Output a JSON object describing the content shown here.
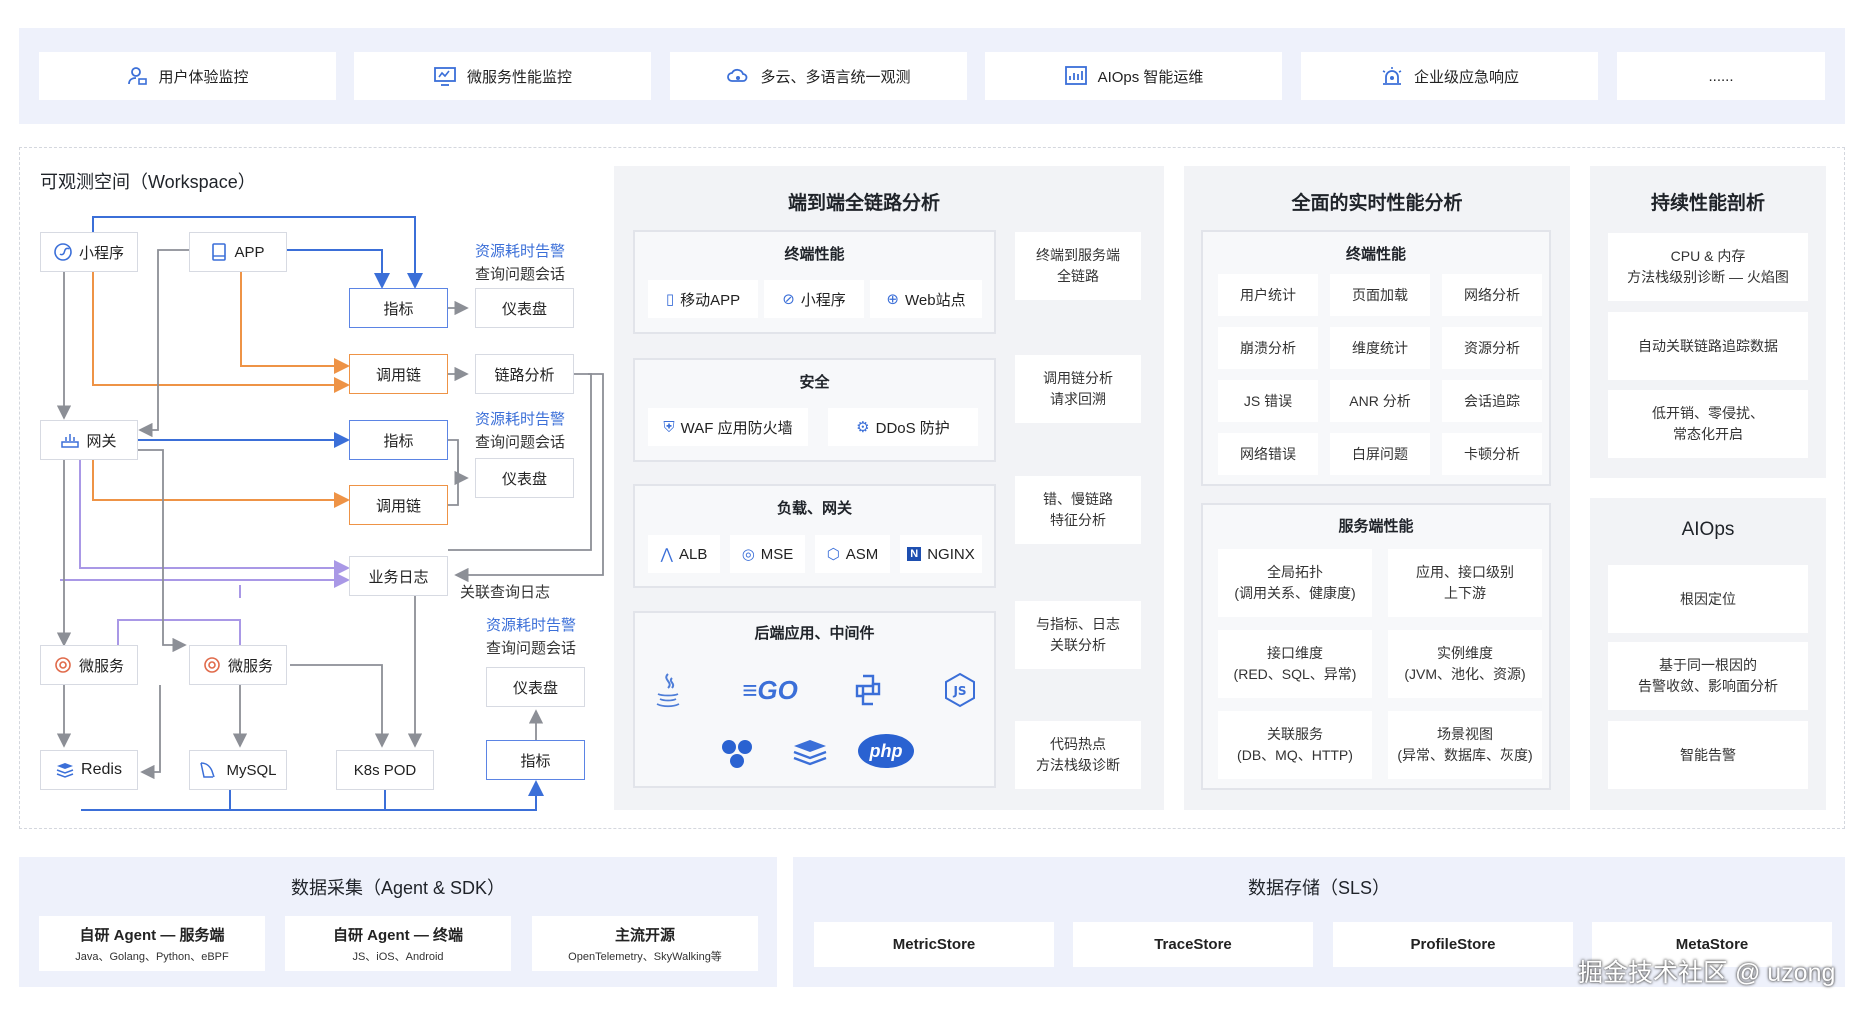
{
  "top_bar": {
    "items": [
      {
        "label": "用户体验监控",
        "icon": "user-monitor-icon"
      },
      {
        "label": "微服务性能监控",
        "icon": "screen-monitor-icon"
      },
      {
        "label": "多云、多语言统一观测",
        "icon": "cloud-icon"
      },
      {
        "label": "AIOps 智能运维",
        "icon": "chart-icon"
      },
      {
        "label": "企业级应急响应",
        "icon": "alarm-icon"
      },
      {
        "label": "......"
      }
    ]
  },
  "workspace": {
    "title": "可观测空间（Workspace）",
    "nodes": {
      "miniprogram": "小程序",
      "app": "APP",
      "gateway": "网关",
      "microservice1": "微服务",
      "microservice2": "微服务",
      "redis": "Redis",
      "mysql": "MySQL",
      "k8s": "K8s POD",
      "metric1": "指标",
      "trace1": "调用链",
      "metric2": "指标",
      "trace2": "调用链",
      "bizlog": "业务日志",
      "metric3": "指标",
      "dashboard1": "仪表盘",
      "tracelink": "链路分析",
      "dashboard2": "仪表盘",
      "dashboard3": "仪表盘"
    },
    "alerts": [
      {
        "line1": "资源耗时告警",
        "line2": "查询问题会话"
      },
      {
        "line1": "资源耗时告警",
        "line2": "查询问题会话"
      },
      {
        "line1": "资源耗时告警",
        "line2": "查询问题会话"
      }
    ],
    "related_log": "关联查询日志"
  },
  "e2e": {
    "title": "端到端全链路分析",
    "terminal": {
      "title": "终端性能",
      "items": [
        "移动APP",
        "小程序",
        "Web站点"
      ]
    },
    "security": {
      "title": "安全",
      "items": [
        "WAF 应用防火墙",
        "DDoS 防护"
      ]
    },
    "lb": {
      "title": "负载、网关",
      "items": [
        "ALB",
        "MSE",
        "ASM",
        "NGINX"
      ]
    },
    "backend": {
      "title": "后端应用、中间件",
      "logos": [
        "java",
        "GO",
        "python",
        "js",
        "flink",
        "stack",
        "php"
      ]
    },
    "right": [
      {
        "l1": "终端到服务端",
        "l2": "全链路"
      },
      {
        "l1": "调用链分析",
        "l2": "请求回溯"
      },
      {
        "l1": "错、慢链路",
        "l2": "特征分析"
      },
      {
        "l1": "与指标、日志",
        "l2": "关联分析"
      },
      {
        "l1": "代码热点",
        "l2": "方法栈级诊断"
      }
    ]
  },
  "realtime": {
    "title": "全面的实时性能分析",
    "terminal": {
      "title": "终端性能",
      "items": [
        "用户统计",
        "页面加载",
        "网络分析",
        "崩溃分析",
        "维度统计",
        "资源分析",
        "JS 错误",
        "ANR 分析",
        "会话追踪",
        "网络错误",
        "白屏问题",
        "卡顿分析"
      ]
    },
    "server": {
      "title": "服务端性能",
      "items": [
        {
          "l1": "全局拓扑",
          "l2": "(调用关系、健康度)"
        },
        {
          "l1": "应用、接口级别",
          "l2": "上下游"
        },
        {
          "l1": "接口维度",
          "l2": "(RED、SQL、异常)"
        },
        {
          "l1": "实例维度",
          "l2": "(JVM、池化、资源)"
        },
        {
          "l1": "关联服务",
          "l2": "(DB、MQ、HTTP)"
        },
        {
          "l1": "场景视图",
          "l2": "(异常、数据库、灰度)"
        }
      ]
    }
  },
  "profiling": {
    "title": "持续性能剖析",
    "items": [
      {
        "l1": "CPU & 内存",
        "l2": "方法栈级别诊断 — 火焰图"
      },
      {
        "l1": "自动关联链路追踪数据",
        "l2": ""
      },
      {
        "l1": "低开销、零侵扰、",
        "l2": "常态化开启"
      }
    ]
  },
  "aiops": {
    "title": "AIOps",
    "items": [
      {
        "l1": "根因定位",
        "l2": ""
      },
      {
        "l1": "基于同一根因的",
        "l2": "告警收敛、影响面分析"
      },
      {
        "l1": "智能告警",
        "l2": ""
      }
    ]
  },
  "collect": {
    "title": "数据采集（Agent & SDK）",
    "items": [
      {
        "t1": "自研 Agent — 服务端",
        "t2": "Java、Golang、Python、eBPF"
      },
      {
        "t1": "自研 Agent — 终端",
        "t2": "JS、iOS、Android"
      },
      {
        "t1": "主流开源",
        "t2": "OpenTelemetry、SkyWalking等"
      }
    ]
  },
  "storage": {
    "title": "数据存储（SLS）",
    "items": [
      "MetricStore",
      "TraceStore",
      "ProfileStore",
      "MetaStore"
    ]
  },
  "watermark": "掘金技术社区 @ uzong",
  "colors": {
    "blue": "#3b6fd8",
    "orange": "#ee9346",
    "purple": "#a998e6",
    "gray": "#8c8f96"
  }
}
